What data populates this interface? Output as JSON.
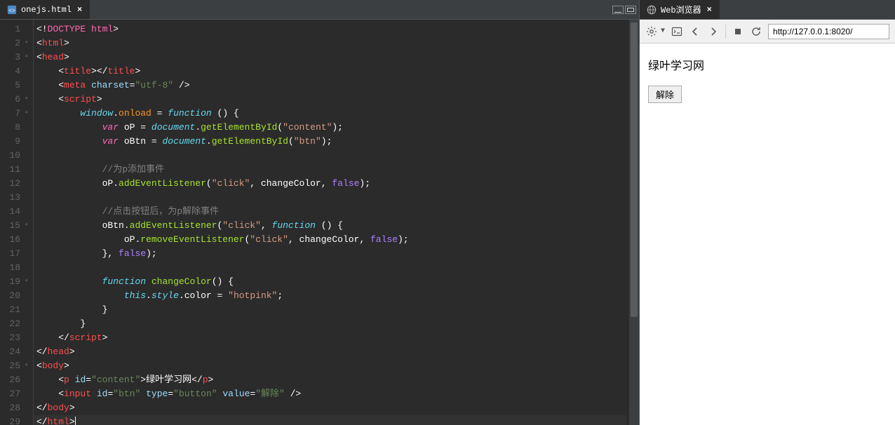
{
  "editor": {
    "tab": {
      "filename": "onejs.html",
      "close_glyph": "×"
    },
    "minmax": {
      "min": "min",
      "max": "max"
    },
    "lines": [
      {
        "n": "1",
        "fold": "",
        "html": "<span class='t-punct'>&lt;!</span><span class='t-doctype'>DOCTYPE html</span><span class='t-punct'>&gt;</span>"
      },
      {
        "n": "2",
        "fold": "▫",
        "html": "<span class='t-punct'>&lt;</span><span class='t-tag'>html</span><span class='t-punct'>&gt;</span>"
      },
      {
        "n": "3",
        "fold": "▫",
        "html": "<span class='t-punct'>&lt;</span><span class='t-tag'>head</span><span class='t-punct'>&gt;</span>"
      },
      {
        "n": "4",
        "fold": "",
        "html": "    <span class='t-punct'>&lt;</span><span class='t-tag'>title</span><span class='t-punct'>&gt;&lt;/</span><span class='t-tag'>title</span><span class='t-punct'>&gt;</span>"
      },
      {
        "n": "5",
        "fold": "",
        "html": "    <span class='t-punct'>&lt;</span><span class='t-tag'>meta</span> <span class='t-attr'>charset</span><span class='t-punct'>=</span><span class='t-str'>\"utf-8\"</span> <span class='t-punct'>/&gt;</span>"
      },
      {
        "n": "6",
        "fold": "▫",
        "html": "    <span class='t-punct'>&lt;</span><span class='t-tag'>script</span><span class='t-punct'>&gt;</span>"
      },
      {
        "n": "7",
        "fold": "▫",
        "html": "        <span class='t-obj'>window</span><span class='t-punct'>.</span><span class='t-prop'>onload</span> <span class='t-punct'>=</span> <span class='t-key2'>function</span> <span class='t-punct'>() {</span>"
      },
      {
        "n": "8",
        "fold": "",
        "html": "            <span class='t-key'>var</span> <span class='t-text'>oP</span> <span class='t-punct'>=</span> <span class='t-obj'>document</span><span class='t-punct'>.</span><span class='t-func'>getElementById</span><span class='t-punct'>(</span><span class='t-str2'>\"content\"</span><span class='t-punct'>);</span>"
      },
      {
        "n": "9",
        "fold": "",
        "html": "            <span class='t-key'>var</span> <span class='t-text'>oBtn</span> <span class='t-punct'>=</span> <span class='t-obj'>document</span><span class='t-punct'>.</span><span class='t-func'>getElementById</span><span class='t-punct'>(</span><span class='t-str2'>\"btn\"</span><span class='t-punct'>);</span>"
      },
      {
        "n": "10",
        "fold": "",
        "html": ""
      },
      {
        "n": "11",
        "fold": "",
        "html": "            <span class='t-comment'>//为p添加事件</span>"
      },
      {
        "n": "12",
        "fold": "",
        "html": "            <span class='t-text'>oP</span><span class='t-punct'>.</span><span class='t-func'>addEventListener</span><span class='t-punct'>(</span><span class='t-str2'>\"click\"</span><span class='t-punct'>,</span> <span class='t-text'>changeColor</span><span class='t-punct'>,</span> <span class='t-bool'>false</span><span class='t-punct'>);</span>"
      },
      {
        "n": "13",
        "fold": "",
        "html": ""
      },
      {
        "n": "14",
        "fold": "",
        "html": "            <span class='t-comment'>//点击按钮后，为p解除事件</span>"
      },
      {
        "n": "15",
        "fold": "▫",
        "html": "            <span class='t-text'>oBtn</span><span class='t-punct'>.</span><span class='t-func'>addEventListener</span><span class='t-punct'>(</span><span class='t-str2'>\"click\"</span><span class='t-punct'>,</span> <span class='t-key2'>function</span> <span class='t-punct'>() {</span>"
      },
      {
        "n": "16",
        "fold": "",
        "html": "                <span class='t-text'>oP</span><span class='t-punct'>.</span><span class='t-func'>removeEventListener</span><span class='t-punct'>(</span><span class='t-str2'>\"click\"</span><span class='t-punct'>,</span> <span class='t-text'>changeColor</span><span class='t-punct'>,</span> <span class='t-bool'>false</span><span class='t-punct'>);</span>"
      },
      {
        "n": "17",
        "fold": "",
        "html": "            <span class='t-punct'>},</span> <span class='t-bool'>false</span><span class='t-punct'>);</span>"
      },
      {
        "n": "18",
        "fold": "",
        "html": ""
      },
      {
        "n": "19",
        "fold": "▫",
        "html": "            <span class='t-key2'>function</span> <span class='t-func'>changeColor</span><span class='t-punct'>() {</span>"
      },
      {
        "n": "20",
        "fold": "",
        "html": "                <span class='t-obj'>this</span><span class='t-punct'>.</span><span class='t-obj'>style</span><span class='t-punct'>.</span><span class='t-text'>color</span> <span class='t-punct'>=</span> <span class='t-str2'>\"hotpink\"</span><span class='t-punct'>;</span>"
      },
      {
        "n": "21",
        "fold": "",
        "html": "            <span class='t-punct'>}</span>"
      },
      {
        "n": "22",
        "fold": "",
        "html": "        <span class='t-punct'>}</span>"
      },
      {
        "n": "23",
        "fold": "",
        "html": "    <span class='t-punct'>&lt;/</span><span class='t-tag'>script</span><span class='t-punct'>&gt;</span>"
      },
      {
        "n": "24",
        "fold": "",
        "html": "<span class='t-punct'>&lt;/</span><span class='t-tag'>head</span><span class='t-punct'>&gt;</span>"
      },
      {
        "n": "25",
        "fold": "▫",
        "html": "<span class='t-punct'>&lt;</span><span class='t-tag'>body</span><span class='t-punct'>&gt;</span>"
      },
      {
        "n": "26",
        "fold": "",
        "html": "    <span class='t-punct'>&lt;</span><span class='t-tag'>p</span> <span class='t-attr'>id</span><span class='t-punct'>=</span><span class='t-str'>\"content\"</span><span class='t-punct'>&gt;</span><span class='t-text'>绿叶学习网</span><span class='t-punct'>&lt;/</span><span class='t-tag'>p</span><span class='t-punct'>&gt;</span>"
      },
      {
        "n": "27",
        "fold": "",
        "html": "    <span class='t-punct'>&lt;</span><span class='t-tag'>input</span> <span class='t-attr'>id</span><span class='t-punct'>=</span><span class='t-str'>\"btn\"</span> <span class='t-attr'>type</span><span class='t-punct'>=</span><span class='t-str'>\"button\"</span> <span class='t-attr'>value</span><span class='t-punct'>=</span><span class='t-str'>\"解除\"</span> <span class='t-punct'>/&gt;</span>"
      },
      {
        "n": "28",
        "fold": "",
        "html": "<span class='t-punct'>&lt;/</span><span class='t-tag'>body</span><span class='t-punct'>&gt;</span>"
      },
      {
        "n": "29",
        "fold": "",
        "html": "<span class='t-punct'>&lt;/</span><span class='t-tag'>html</span><span class='t-punct'>&gt;</span><span class='t-cursor'></span>",
        "current": true
      }
    ]
  },
  "browser": {
    "tab_label": "Web浏览器",
    "tab_close": "×",
    "url": "http://127.0.0.1:8020/",
    "page_text": "绿叶学习网",
    "button_label": "解除"
  }
}
